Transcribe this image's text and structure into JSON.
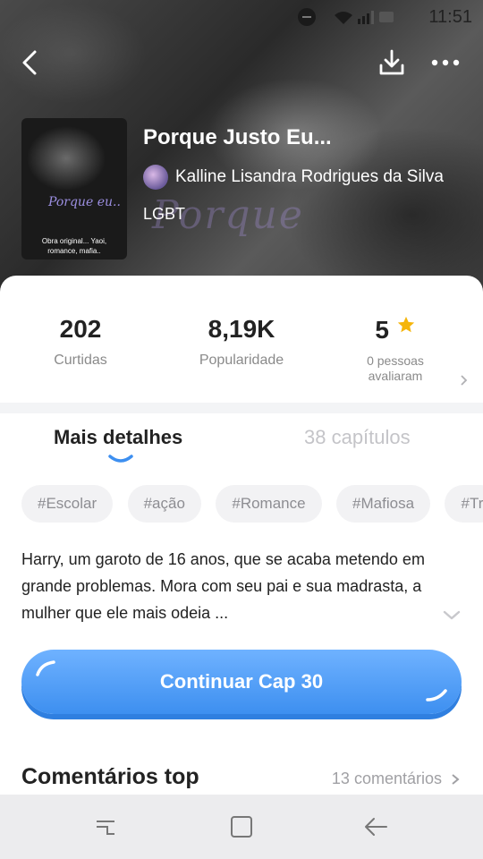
{
  "status_bar": {
    "time": "11:51",
    "icons": "wifi, signal, battery"
  },
  "header": {
    "title": "Porque Justo Eu...",
    "author": "Kalline Lisandra Rodrigues da Silva",
    "genre": "LGBT",
    "watermark": "Porque",
    "cover_title": "Porque eu..",
    "cover_subtitle": "Obra original... Yaoi, romance, mafia..",
    "icons": {
      "back": "back-arrow-icon",
      "download": "download-icon",
      "more": "more-dots-icon"
    }
  },
  "stats": [
    {
      "value": "202",
      "label": "Curtidas"
    },
    {
      "value": "8,19K",
      "label": "Popularidade"
    },
    {
      "value": "5",
      "label_line1": "0 pessoas",
      "label_line2": "avaliaram",
      "star_color": "#f5b50a"
    }
  ],
  "tabs": {
    "details": "Mais detalhes",
    "chapters": "38 capítulos",
    "accent": "#3d8ff0"
  },
  "tags": [
    "#Escolar",
    "#ação",
    "#Romance",
    "#Mafiosa",
    "#Tr"
  ],
  "synopsis": "Harry, um garoto de 16 anos, que se acaba metendo em grande problemas. Mora com seu pai e sua madrasta, a mulher que ele mais odeia ...",
  "cta": {
    "label": "Continuar Cap 30",
    "color": "#4a9bf5"
  },
  "comments": {
    "title": "Comentários top",
    "count_label": "13 comentários"
  }
}
